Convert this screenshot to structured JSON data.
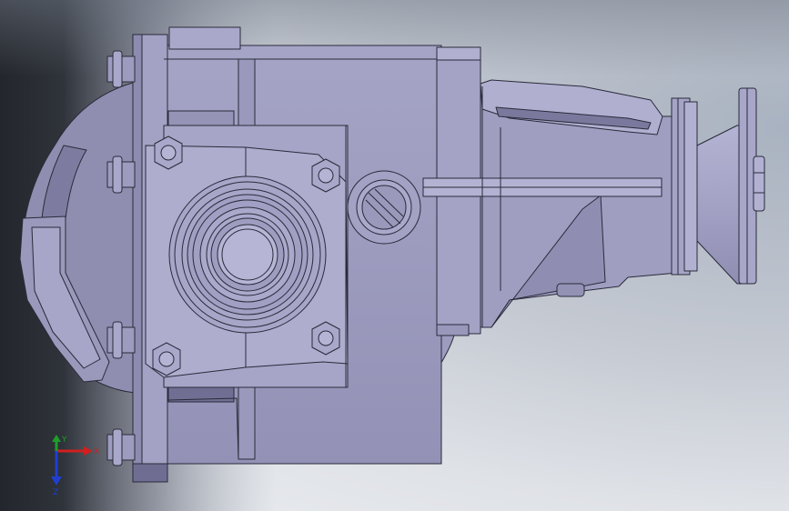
{
  "scene": {
    "type": "cad-model-viewport",
    "colors": {
      "part": "#9c9bbd",
      "part_light": "#b3b2d3",
      "part_dark": "#78779a",
      "edge": "#2a2a3a",
      "background_dark": "#2a2e36",
      "background_light": "#e4e6ea"
    }
  },
  "triad": {
    "x_label": "X",
    "y_label": "Y",
    "z_label": "Z",
    "x_color": "#d21f1f",
    "y_color": "#1e9e2a",
    "z_color": "#1f3fd2"
  }
}
